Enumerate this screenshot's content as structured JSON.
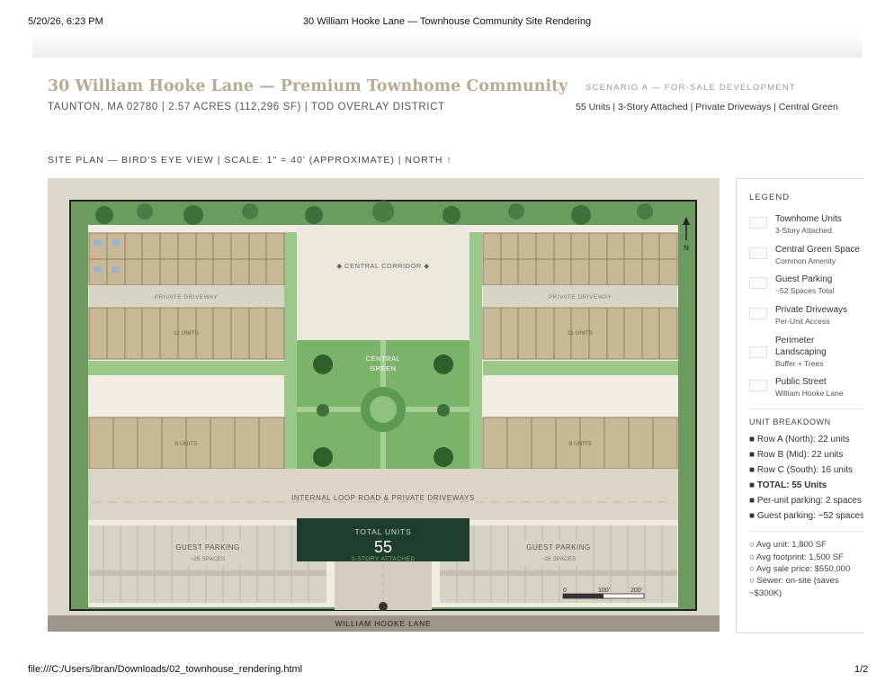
{
  "print": {
    "datetime": "5/20/26, 6:23 PM",
    "doc_title": "30 William Hooke Lane — Townhouse Community Site Rendering",
    "url": "file:///C:/Users/ibran/Downloads/02_townhouse_rendering.html",
    "page": "1/2"
  },
  "header": {
    "title": "30 William Hooke Lane — Premium Townhome Community",
    "subtitle": "TAUNTON, MA 02780  |  2.57 ACRES (112,296 SF)  |  TOD OVERLAY DISTRICT",
    "scenario_label": "SCENARIO A — FOR-SALE DEVELOPMENT",
    "scenario_summary": "55 Units  |  3-Story Attached  |  Private Driveways  |  Central Green"
  },
  "plan": {
    "caption": "SITE PLAN — BIRD'S EYE VIEW  |  SCALE: 1\" = 40' (APPROXIMATE)  |  NORTH ↑",
    "north": "N",
    "driveway_label": "PRIVATE DRIVEWAY",
    "corridor_label": "◆ CENTRAL CORRIDOR ◆",
    "green_label_1": "CENTRAL",
    "green_label_2": "GREEN",
    "row_units_top": "11 UNITS",
    "row_units_mid": "8 UNITS",
    "loop_label": "INTERNAL LOOP ROAD & PRIVATE DRIVEWAYS",
    "parking_label": "GUEST PARKING",
    "parking_spaces": "~26 SPACES",
    "total_label": "TOTAL UNITS",
    "total_value": "55",
    "total_sub": "3-STORY ATTACHED",
    "street": "WILLIAM HOOKE LANE",
    "scale_ticks": [
      "0",
      "100'",
      "200'"
    ]
  },
  "legend": {
    "heading": "LEGEND",
    "items": [
      {
        "name": "Townhome Units",
        "desc": "3-Story Attached"
      },
      {
        "name": "Central Green Space",
        "desc": "Common Amenity"
      },
      {
        "name": "Guest Parking",
        "desc": "~52 Spaces Total"
      },
      {
        "name": "Private Driveways",
        "desc": "Per-Unit Access"
      },
      {
        "name": "Perimeter Landscaping",
        "desc": "Buffer + Trees"
      },
      {
        "name": "Public Street",
        "desc": "William Hooke Lane"
      }
    ],
    "breakdown_heading": "UNIT BREAKDOWN",
    "breakdown": [
      "■ Row A (North): 22 units",
      "■ Row B (Mid): 22 units",
      "■ Row C (South): 16 units",
      "■ TOTAL: 55 Units",
      "■ Per-unit parking: 2 spaces",
      "■ Guest parking: ~52 spaces"
    ],
    "notes": [
      "○ Avg unit: 1,800 SF",
      "○ Avg footprint: 1,500 SF",
      "○ Avg sale price: $550,000",
      "○ Sewer: on-site (saves",
      "~$300K)"
    ]
  }
}
